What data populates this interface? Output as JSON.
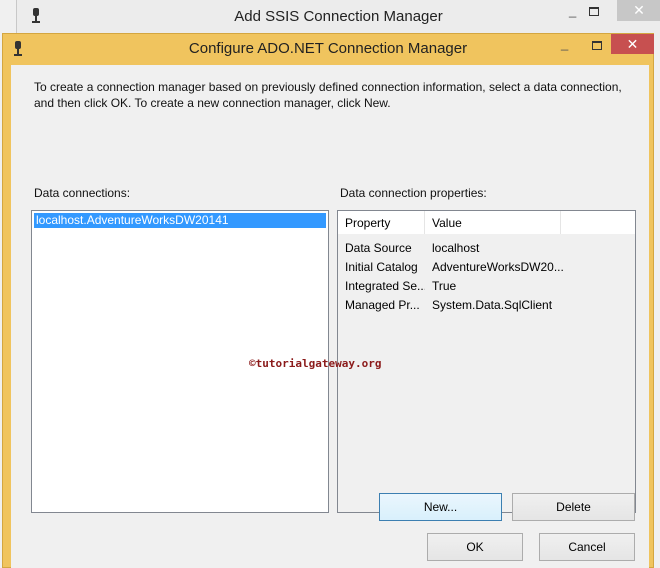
{
  "back_window": {
    "title": "Add SSIS Connection Manager",
    "icon": "plug-icon"
  },
  "dialog": {
    "title": "Configure ADO.NET Connection Manager",
    "icon": "plug-icon",
    "intro": "To create a connection manager based on previously defined connection information, select a data connection, and then click OK. To create a new connection manager, click New.",
    "connections_label": "Data connections:",
    "connections": [
      "localhost.AdventureWorksDW20141"
    ],
    "properties_label": "Data connection properties:",
    "properties_headers": [
      "Property",
      "Value"
    ],
    "properties": [
      {
        "name": "Data Source",
        "value": "localhost"
      },
      {
        "name": "Initial Catalog",
        "value": "AdventureWorksDW20..."
      },
      {
        "name": "Integrated Se...",
        "value": "True"
      },
      {
        "name": "Managed Pr...",
        "value": "System.Data.SqlClient"
      }
    ],
    "buttons": {
      "new": "New...",
      "delete": "Delete",
      "ok": "OK",
      "cancel": "Cancel"
    },
    "watermark": "©tutorialgateway.org"
  },
  "window_controls": {
    "minimize": "_",
    "close": "✕"
  },
  "colors": {
    "title_active": "#f0c45e",
    "close_active": "#c75050",
    "selection": "#3399ff"
  }
}
